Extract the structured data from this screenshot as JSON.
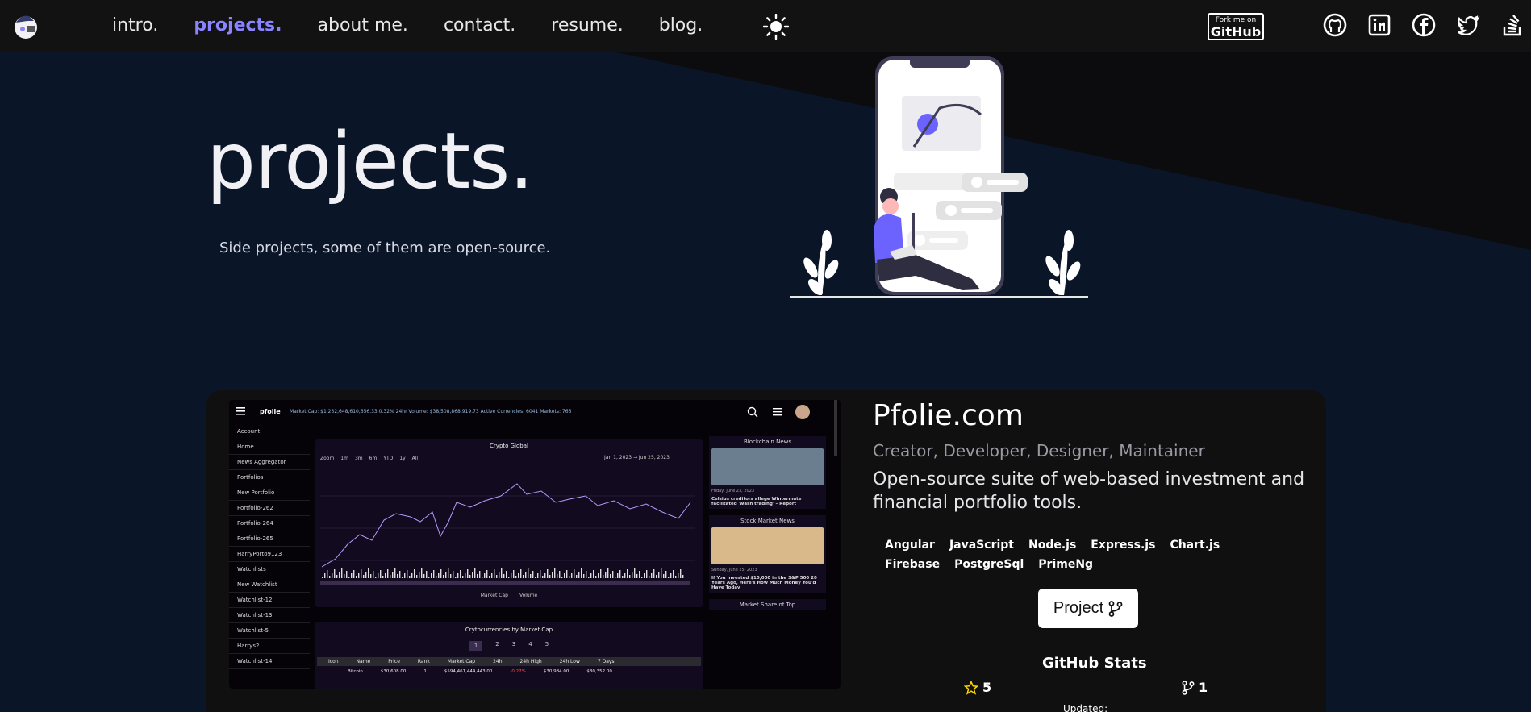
{
  "nav": {
    "links": [
      "intro.",
      "projects.",
      "about me.",
      "contact.",
      "resume.",
      "blog."
    ],
    "active_index": 1,
    "fork_badge": {
      "line1": "Fork me on",
      "line2": "GitHub"
    },
    "socials": [
      "github-icon",
      "linkedin-icon",
      "facebook-icon",
      "twitter-icon",
      "stackoverflow-icon"
    ]
  },
  "hero": {
    "title": "projects.",
    "subtitle": "Side projects, some of them are open-source."
  },
  "project": {
    "title": "Pfolie.com",
    "roles": "Creator, Developer, Designer, Maintainer",
    "description": "Open-source suite of web-based investment and financial portfolio tools.",
    "tags": [
      "Angular",
      "JavaScript",
      "Node.js",
      "Express.js",
      "Chart.js",
      "Firebase",
      "PostgreSql",
      "PrimeNg"
    ],
    "button_label": "Project",
    "stats_title": "GitHub Stats",
    "stars": "5",
    "forks": "1",
    "updated_label": "Updated:"
  },
  "screenshot": {
    "brand": "pfolie",
    "ticker": "Market Cap: $1,232,648,610,656.33  0.32%   24hr Volume: $38,508,868,919.73   Active Currencies: 6041   Markets: 766",
    "sidebar": [
      "Account",
      "Home",
      "News Aggregator",
      "Portfolios",
      "New Portfolio",
      "Portfolio-262",
      "Portfolio-264",
      "Portfolio-265",
      "HarryPorto9123",
      "Watchlists",
      "New Watchlist",
      "Watchlist-12",
      "Watchlist-13",
      "Watchlist-5",
      "Harrys2",
      "Watchlist-14"
    ],
    "chart_title": "Crypto Global",
    "chart_ranges": [
      "Zoom",
      "1m",
      "3m",
      "6m",
      "YTD",
      "1y",
      "All"
    ],
    "chart_dates": "Jan 1, 2023  →  Jun 25, 2023",
    "chart_legend": [
      "Market Cap",
      "Volume"
    ],
    "table_title": "Crytocurrencies by Market Cap",
    "pages": [
      "1",
      "2",
      "3",
      "4",
      "5"
    ],
    "table_headers": [
      "Icon",
      "Name",
      "Price",
      "Rank",
      "Market Cap",
      "24h",
      "24h High",
      "24h Low",
      "7 Days"
    ],
    "table_row": [
      "Bitcoin",
      "$30,608.00",
      "1",
      "$594,461,444,443.00",
      "-0.27%",
      "$30,984.00",
      "$30,352.00"
    ],
    "news_sections": [
      "Blockchain News",
      "Stock Market News",
      "Market Share of Top"
    ],
    "news_items": [
      {
        "date": "Friday, June 23, 2023",
        "headline": "Celsius creditors allege Wintermute facilitated 'wash trading' – Report"
      },
      {
        "date": "Sunday, June 25, 2023",
        "headline": "If You Invested $10,000 in the S&P 500 20 Years Ago, Here's How Much Money You'd Have Today"
      }
    ]
  },
  "colors": {
    "accent": "#8b84ff",
    "nav_bg": "#121212",
    "hero_bg": "#0a1628",
    "card_bg": "#101010"
  }
}
